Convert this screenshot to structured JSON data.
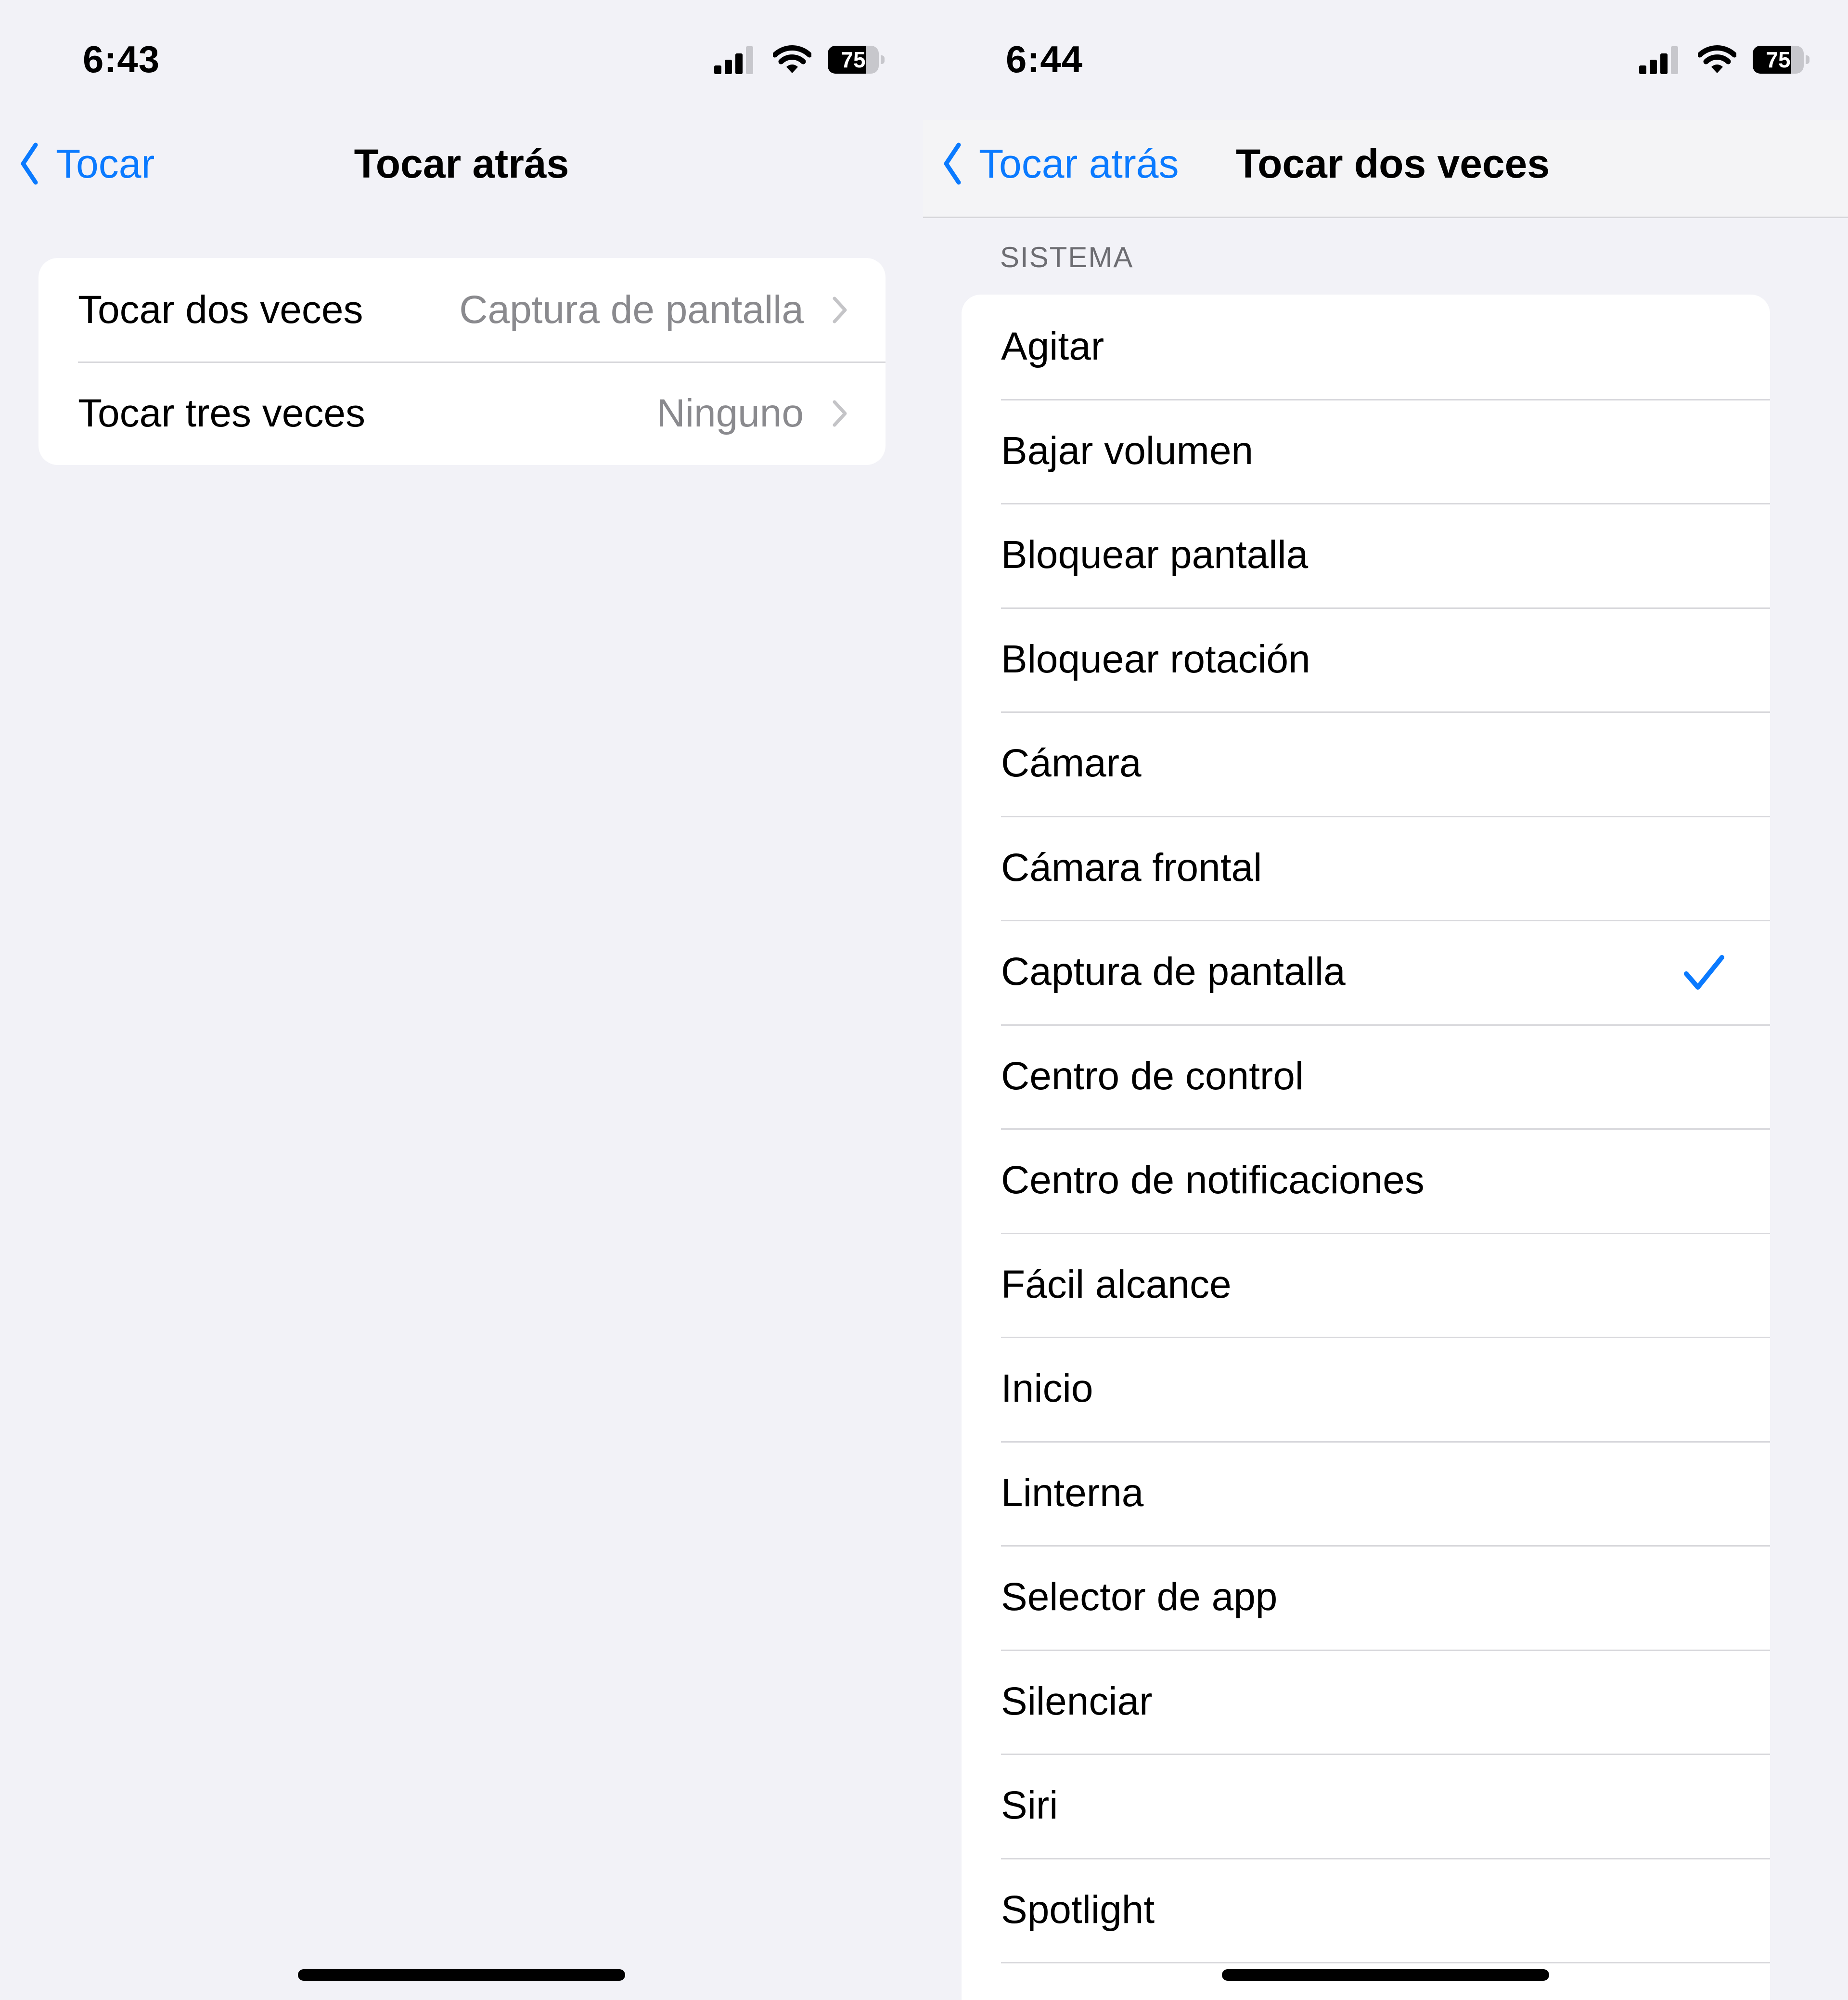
{
  "colors": {
    "accent": "#0a7aff",
    "background": "#f2f2f7",
    "secondary_text": "#8a8a8e",
    "separator": "#d8d8dc"
  },
  "left_screen": {
    "status_bar": {
      "time": "6:43",
      "battery_percent": "75",
      "battery_level": 0.75
    },
    "nav": {
      "back_label": "Tocar",
      "title": "Tocar atrás"
    },
    "settings": [
      {
        "label": "Tocar dos veces",
        "value": "Captura de pantalla"
      },
      {
        "label": "Tocar tres veces",
        "value": "Ninguno"
      }
    ]
  },
  "right_screen": {
    "status_bar": {
      "time": "6:44",
      "battery_percent": "75",
      "battery_level": 0.75
    },
    "nav": {
      "back_label": "Tocar atrás",
      "title": "Tocar dos veces"
    },
    "section_header": "SISTEMA",
    "options": [
      {
        "label": "Agitar"
      },
      {
        "label": "Bajar volumen"
      },
      {
        "label": "Bloquear pantalla"
      },
      {
        "label": "Bloquear rotación"
      },
      {
        "label": "Cámara"
      },
      {
        "label": "Cámara frontal"
      },
      {
        "label": "Captura de pantalla",
        "selected": true
      },
      {
        "label": "Centro de control"
      },
      {
        "label": "Centro de notificaciones"
      },
      {
        "label": "Fácil alcance"
      },
      {
        "label": "Inicio"
      },
      {
        "label": "Linterna"
      },
      {
        "label": "Selector de app"
      },
      {
        "label": "Silenciar"
      },
      {
        "label": "Siri"
      },
      {
        "label": "Spotlight"
      },
      {
        "label": ""
      }
    ]
  }
}
